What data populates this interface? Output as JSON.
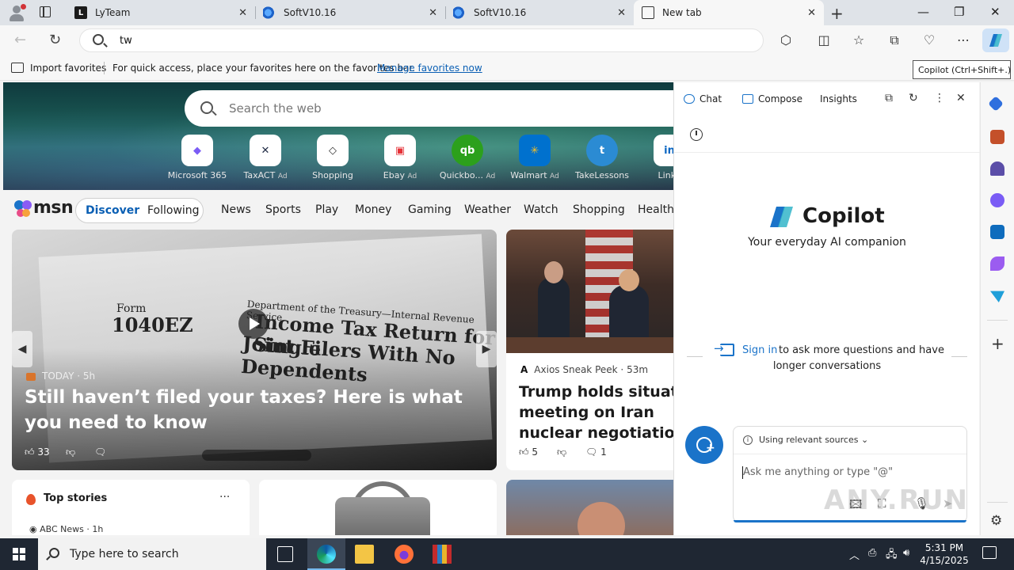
{
  "tabs": [
    {
      "title": "LyTeam",
      "favicon": "lyteam-favicon",
      "active": false
    },
    {
      "title": "SoftV10.16",
      "favicon": "softv-favicon",
      "active": false
    },
    {
      "title": "SoftV10.16",
      "favicon": "softv-favicon",
      "active": false
    },
    {
      "title": "New tab",
      "favicon": "newtab-favicon",
      "active": true
    }
  ],
  "address": {
    "value": "tw"
  },
  "favorites_bar": {
    "import_label": "Import favorites",
    "hint": "For quick access, place your favorites here on the favorites bar.",
    "manage_label": "Manage favorites now"
  },
  "tooltip": "Copilot (Ctrl+Shift+.)",
  "newtab": {
    "search_placeholder": "Search the web",
    "tiles": [
      {
        "label": "Microsoft 365",
        "ad": "",
        "glyph": "◆"
      },
      {
        "label": "TaxACT",
        "ad": "Ad",
        "glyph": "✕"
      },
      {
        "label": "Shopping",
        "ad": "",
        "glyph": "◇"
      },
      {
        "label": "Ebay",
        "ad": "Ad",
        "glyph": "▣"
      },
      {
        "label": "Quickbo...",
        "ad": "Ad",
        "glyph": "qb"
      },
      {
        "label": "Walmart",
        "ad": "Ad",
        "glyph": "✳"
      },
      {
        "label": "TakeLessons",
        "ad": "",
        "glyph": "t"
      },
      {
        "label": "Linke",
        "ad": "",
        "glyph": "in"
      }
    ]
  },
  "msn": {
    "logo_text": "msn",
    "discover": "Discover",
    "following": "Following",
    "nav": [
      "News",
      "Sports",
      "Play",
      "Money",
      "Gaming",
      "Weather",
      "Watch",
      "Shopping",
      "Health"
    ]
  },
  "main_card": {
    "source": "TODAY",
    "age": "5h",
    "headline": "Still haven’t filed your taxes? Here is what you need to know",
    "likes": "33",
    "image_text": {
      "form_label": "Form",
      "form_number": "1040EZ",
      "dept": "Department of the Treasury—Internal Revenue Service",
      "title1": "Income Tax Return for Single",
      "title2": "Joint Filers With No Dependents"
    }
  },
  "side_card": {
    "source": "Axios Sneak Peek",
    "age": "53m",
    "headline": "Trump holds situation meeting on Iran nuclear negotiations",
    "likes": "5",
    "comments": "1"
  },
  "top_stories": {
    "title": "Top stories",
    "source": "ABC News",
    "age": "1h"
  },
  "copilot": {
    "tabs": {
      "chat": "Chat",
      "compose": "Compose",
      "insights": "Insights"
    },
    "name": "Copilot",
    "tagline": "Your everyday AI companion",
    "signin": "Sign in",
    "signin_rest1": "to ask more questions and have",
    "signin_rest2": "longer conversations",
    "sources": "Using relevant sources",
    "placeholder": "Ask me anything or type \"@\""
  },
  "watermark": "ANY.RUN",
  "taskbar": {
    "search_placeholder": "Type here to search",
    "time": "5:31 PM",
    "date": "4/15/2025"
  },
  "colors": {
    "accent": "#1a73c9",
    "taskbar": "#1f2733",
    "link": "#0a5fb4"
  }
}
